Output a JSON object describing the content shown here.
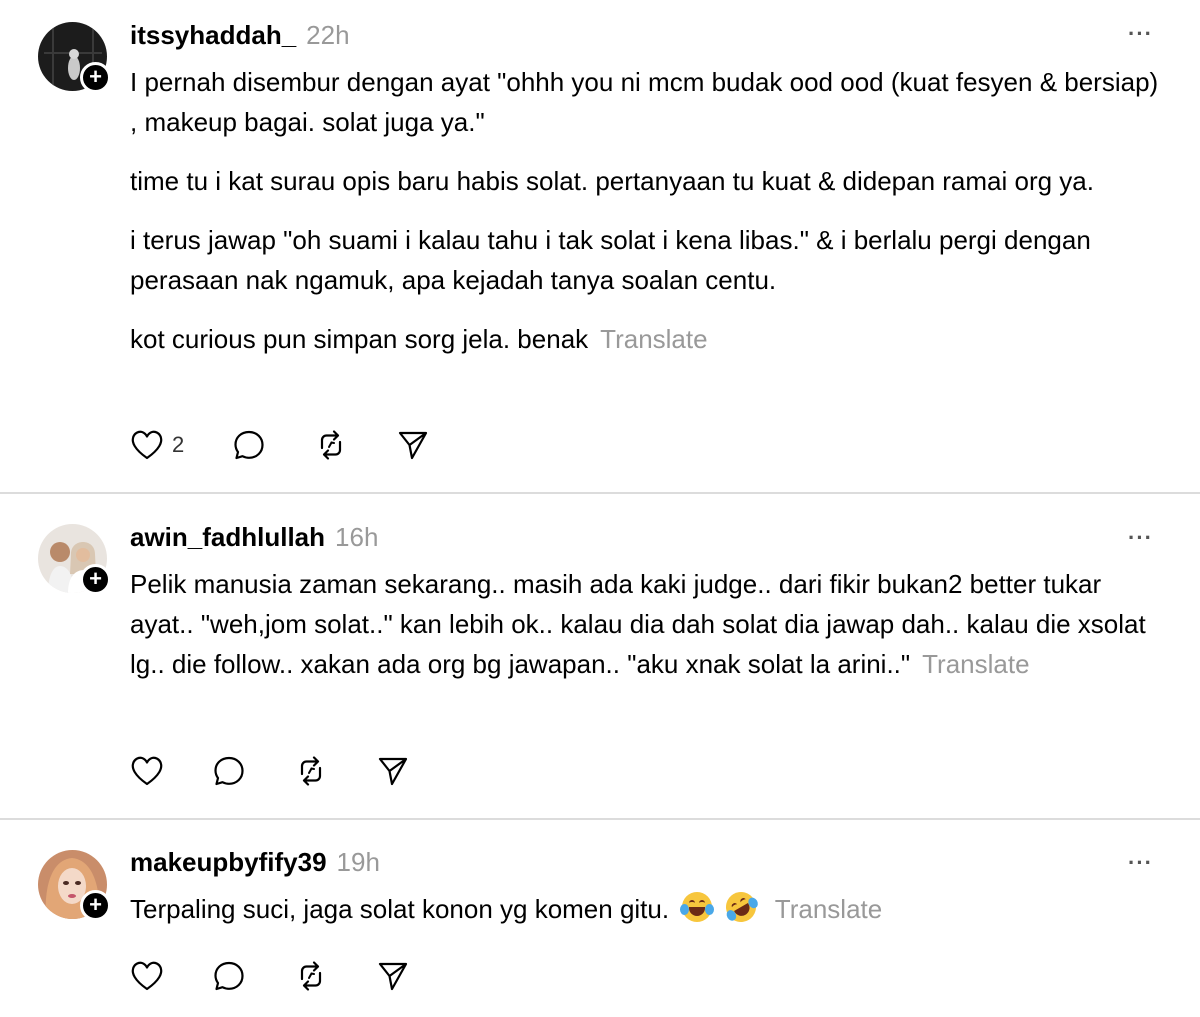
{
  "posts": [
    {
      "username": "itssyhaddah_",
      "time": "22h",
      "paragraphs": [
        "I pernah disembur dengan ayat \"ohhh you ni mcm budak ood ood (kuat fesyen & bersiap) , makeup bagai. solat juga ya.\"",
        "time tu i kat surau opis baru habis solat. pertanyaan tu kuat & didepan ramai org ya.",
        "i terus jawap \"oh suami i kalau tahu i tak solat i kena libas.\" & i berlalu pergi dengan perasaan nak ngamuk, apa kejadah tanya soalan centu.",
        "kot curious pun simpan sorg jela. benak"
      ],
      "translate_label": "Translate",
      "like_count": "2"
    },
    {
      "username": "awin_fadhlullah",
      "time": "16h",
      "paragraphs": [
        "Pelik manusia zaman sekarang.. masih ada kaki judge.. dari fikir bukan2 better tukar ayat.. \"weh,jom solat..\" kan lebih ok.. kalau dia dah solat dia jawap dah.. kalau die xsolat lg.. die follow.. xakan ada org bg jawapan.. \"aku xnak solat la arini..\""
      ],
      "translate_label": "Translate",
      "like_count": ""
    },
    {
      "username": "makeupbyfify39",
      "time": "19h",
      "paragraphs": [
        "Terpaling suci, jaga solat konon yg komen gitu."
      ],
      "emojis": [
        "face-with-tears-of-joy",
        "rolling-on-floor-laughing"
      ],
      "translate_label": "Translate",
      "like_count": ""
    }
  ],
  "icons": {
    "more": "more-horizontal-icon",
    "follow": "plus-icon",
    "like": "heart-icon",
    "reply": "comment-icon",
    "repost": "repost-icon",
    "share": "send-icon"
  },
  "colors": {
    "text": "#000000",
    "muted": "#999999",
    "divider": "#dcdcdc",
    "follow_badge": "#000000"
  },
  "more_glyph": "···",
  "follow_glyph": "+"
}
